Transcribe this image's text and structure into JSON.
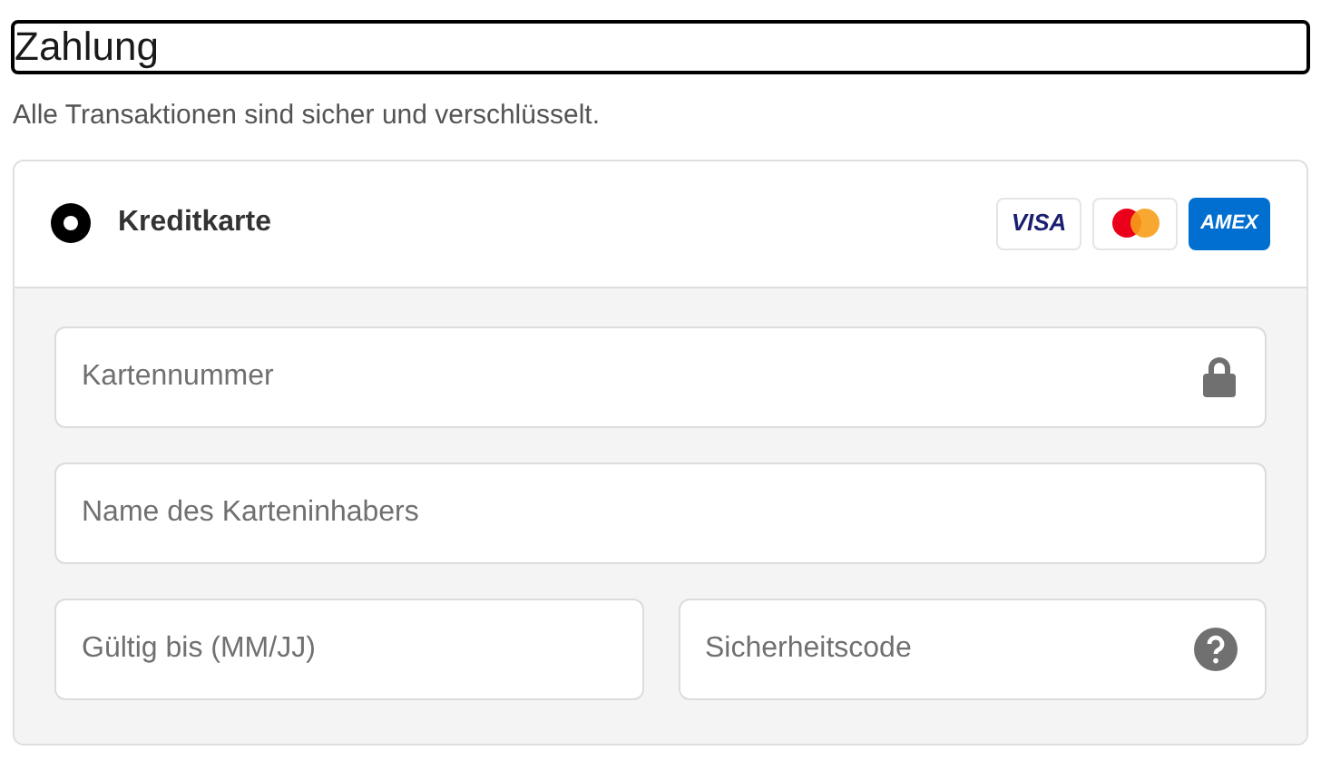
{
  "heading": "Zahlung",
  "subtitle": "Alle Transaktionen sind sicher und verschlüsselt.",
  "payment_method": {
    "label": "Kreditkarte",
    "selected": true
  },
  "card_brands": [
    {
      "kind": "visa",
      "label": "VISA"
    },
    {
      "kind": "mastercard"
    },
    {
      "kind": "amex",
      "label": "AMEX"
    }
  ],
  "fields": [
    {
      "placeholder": "Kartennummer",
      "kind": "lock"
    },
    {
      "placeholder": "Name des Karteninhabers",
      "kind": "plain"
    },
    {
      "placeholder": "Gültig bis (MM/JJ)",
      "kind": "plain"
    },
    {
      "placeholder": "Sicherheitscode",
      "kind": "help"
    }
  ]
}
